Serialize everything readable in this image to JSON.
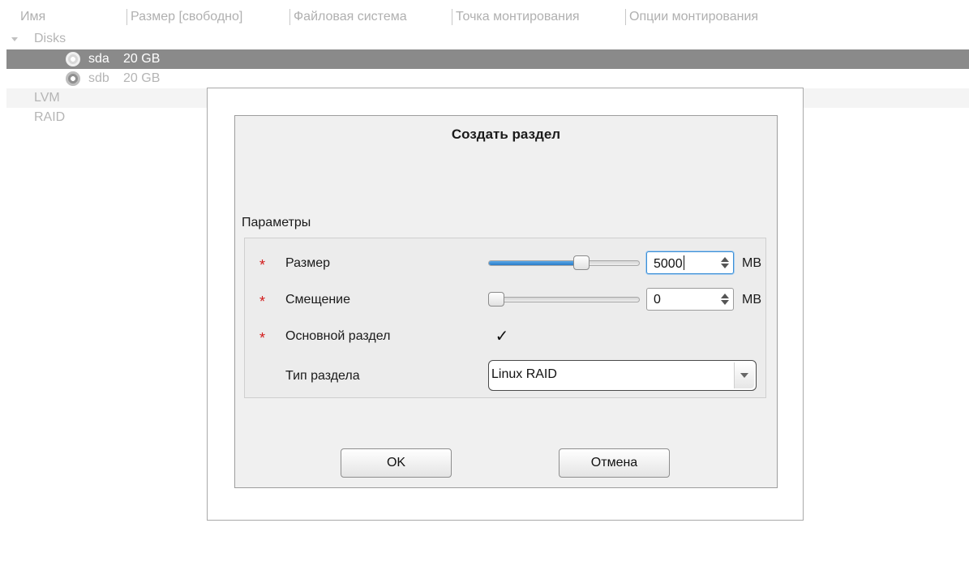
{
  "tree": {
    "columns": [
      "Имя",
      "Размер [свободно]",
      "Файловая система",
      "Точка монтирования",
      "Опции монтирования"
    ],
    "groups": {
      "disks": "Disks",
      "lvm": "LVM",
      "raid": "RAID"
    },
    "disks": [
      {
        "name": "sda",
        "size": "20 GB",
        "selected": true
      },
      {
        "name": "sdb",
        "size": "20 GB",
        "selected": false
      }
    ]
  },
  "dialog": {
    "title": "Создать раздел",
    "group_label": "Параметры",
    "size": {
      "label": "Размер",
      "value": "5000",
      "unit": "MB",
      "slider_fraction": 0.63
    },
    "offset": {
      "label": "Смещение",
      "value": "0",
      "unit": "MB",
      "slider_fraction": 0.0
    },
    "primary": {
      "label": "Основной раздел",
      "checked": true,
      "mark": "✓"
    },
    "partition_type": {
      "label": "Тип раздела",
      "selected": "Linux RAID"
    },
    "required_marker": "*",
    "ok_label": "OK",
    "cancel_label": "Отмена"
  },
  "colors": {
    "required": "#d21a1a",
    "accent": "#3c8fd6",
    "selected_row": "#8a8a8a"
  },
  "icons": {
    "disk": "hard-disk-icon",
    "expander": "triangle-down-icon",
    "spin": "spin-arrows-icon",
    "combo": "dropdown-arrow-icon"
  }
}
